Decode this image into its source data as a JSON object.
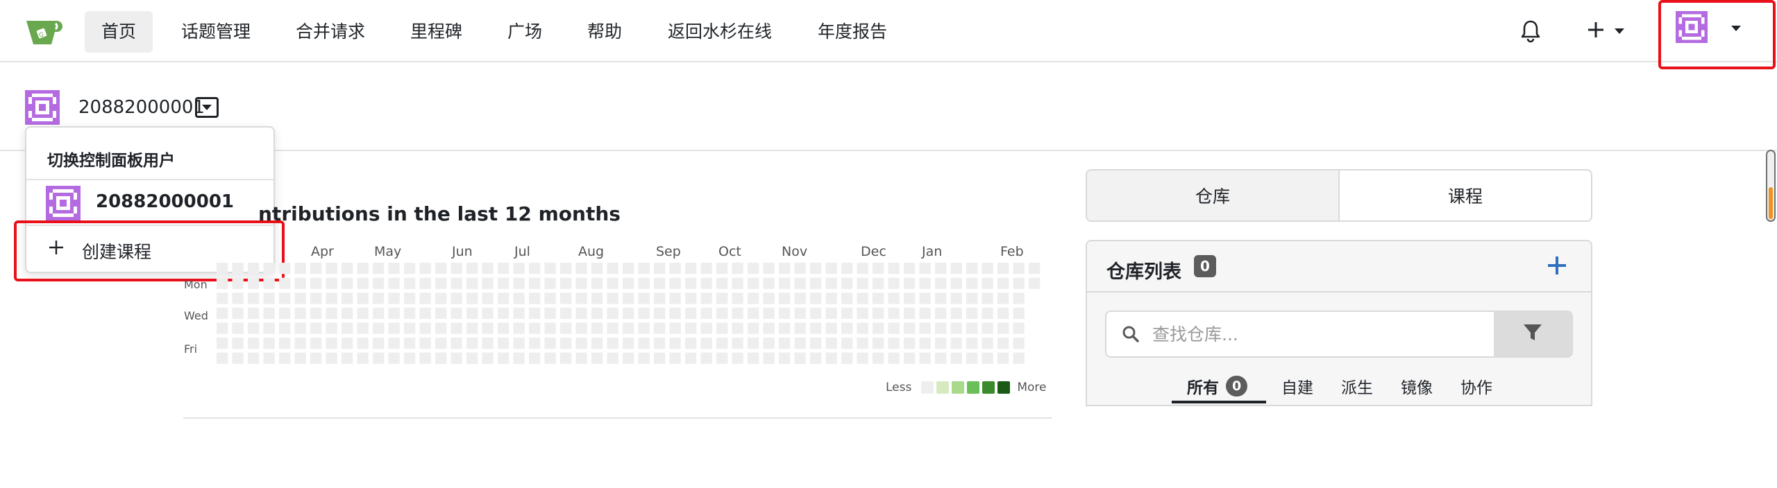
{
  "nav": {
    "logo_icon": "teacup-logo-icon",
    "items": [
      {
        "label": "首页",
        "active": true
      },
      {
        "label": "话题管理"
      },
      {
        "label": "合并请求"
      },
      {
        "label": "里程碑"
      },
      {
        "label": "广场"
      },
      {
        "label": "帮助"
      },
      {
        "label": "返回水杉在线"
      },
      {
        "label": "年度报告"
      }
    ],
    "notification_icon": "bell-icon",
    "create_icon": "plus-icon",
    "avatar_icon": "identicon-avatar"
  },
  "dashboard": {
    "username": "20882000001",
    "dropdown": {
      "header": "切换控制面板用户",
      "user": "20882000001",
      "create_label": "创建课程"
    }
  },
  "heatmap": {
    "title": "ntributions in the last 12 months",
    "months": [
      "Apr",
      "May",
      "Jun",
      "Jul",
      "Aug",
      "Sep",
      "Oct",
      "Nov",
      "Dec",
      "Jan",
      "Feb"
    ],
    "days": [
      "Mon",
      "Wed",
      "Fri"
    ],
    "legend_less": "Less",
    "legend_more": "More",
    "legend_colors": [
      "#eeeeee",
      "#d6e9c1",
      "#a9d98b",
      "#6bbf59",
      "#3c8a2e",
      "#1a5a14"
    ],
    "empty_color": "#eeeeee"
  },
  "right_panel": {
    "tabs": [
      {
        "label": "仓库",
        "active": true
      },
      {
        "label": "课程"
      }
    ],
    "repo_list_title": "仓库列表",
    "repo_count": "0",
    "search_placeholder": "查找仓库...",
    "subtabs": [
      {
        "label": "所有",
        "count": "0",
        "active": true
      },
      {
        "label": "自建"
      },
      {
        "label": "派生"
      },
      {
        "label": "镜像"
      },
      {
        "label": "协作"
      }
    ]
  },
  "colors": {
    "highlight": "#e8101a",
    "accent_blue": "#2f6fbe",
    "logo_green": "#6aa84f",
    "identicon_purple": "#b46ae0"
  }
}
